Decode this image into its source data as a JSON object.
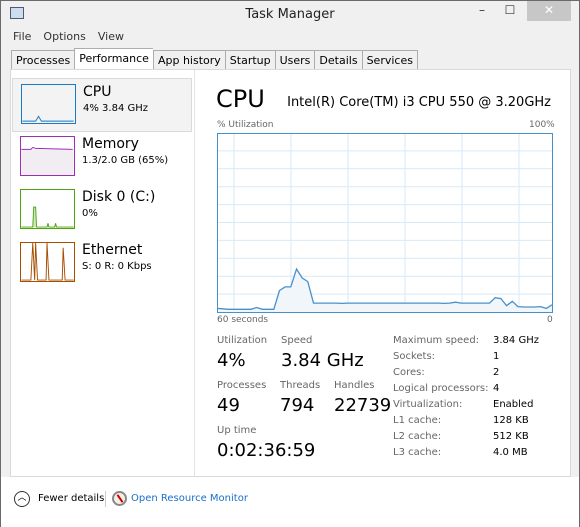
{
  "window": {
    "title": "Task Manager",
    "close": "✕",
    "minimize": "–",
    "maximize": "☐"
  },
  "menu": [
    "File",
    "Options",
    "View"
  ],
  "tabs": [
    "Processes",
    "Performance",
    "App history",
    "Startup",
    "Users",
    "Details",
    "Services"
  ],
  "active_tab": "Performance",
  "sidebar": [
    {
      "name": "CPU",
      "sub": "4%  3.84 GHz",
      "color": "#1a7ac4"
    },
    {
      "name": "Memory",
      "sub": "1.3/2.0 GB (65%)",
      "color": "#9b30b4"
    },
    {
      "name": "Disk 0 (C:)",
      "sub": "0%",
      "color": "#4da60c"
    },
    {
      "name": "Ethernet",
      "sub": "S: 0 R: 0 Kbps",
      "color": "#a74f01"
    }
  ],
  "main": {
    "title": "CPU",
    "processor": "Intel(R) Core(TM) i3 CPU 550 @ 3.20GHz",
    "ylabel": "% Utilization",
    "ymax_label": "100%",
    "xleft": "60 seconds",
    "xright": "0"
  },
  "chart_data": {
    "type": "area",
    "xlabel": "60 seconds",
    "ylim": [
      0,
      100
    ],
    "xlim": [
      60,
      0
    ],
    "grid": true,
    "color": "#4a90c8",
    "values": [
      2,
      1.8,
      1.5,
      1.5,
      1.5,
      1.5,
      1.5,
      2.5,
      1.5,
      1.5,
      1.5,
      12,
      14,
      14,
      24,
      19,
      17,
      5,
      5,
      5,
      5,
      5,
      4.8,
      5,
      5,
      5,
      5,
      5,
      5,
      5,
      5,
      5,
      5,
      5,
      5,
      5,
      5,
      5,
      5,
      5,
      4.8,
      5,
      5.5,
      5,
      5,
      5,
      5,
      5,
      5,
      8,
      7.5,
      3.5,
      6,
      3,
      2.8,
      2.8,
      2.8,
      3,
      2,
      4
    ]
  },
  "stats": {
    "utilization": {
      "label": "Utilization",
      "value": "4%"
    },
    "speed": {
      "label": "Speed",
      "value": "3.84 GHz"
    },
    "processes": {
      "label": "Processes",
      "value": "49"
    },
    "threads": {
      "label": "Threads",
      "value": "794"
    },
    "handles": {
      "label": "Handles",
      "value": "22739"
    },
    "uptime": {
      "label": "Up time",
      "value": "0:02:36:59"
    }
  },
  "specs": [
    {
      "k": "Maximum speed:",
      "v": "3.84 GHz"
    },
    {
      "k": "Sockets:",
      "v": "1"
    },
    {
      "k": "Cores:",
      "v": "2"
    },
    {
      "k": "Logical processors:",
      "v": "4"
    },
    {
      "k": "Virtualization:",
      "v": "Enabled"
    },
    {
      "k": "L1 cache:",
      "v": "128 KB"
    },
    {
      "k": "L2 cache:",
      "v": "512 KB"
    },
    {
      "k": "L3 cache:",
      "v": "4.0 MB"
    }
  ],
  "footer": {
    "fewer": "Fewer details",
    "resmon": "Open Resource Monitor"
  }
}
